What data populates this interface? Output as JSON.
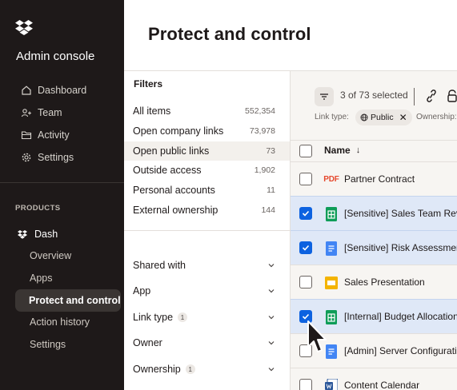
{
  "sidebar": {
    "app_title": "Admin console",
    "nav": [
      {
        "label": "Dashboard",
        "icon": "home-icon"
      },
      {
        "label": "Team",
        "icon": "team-icon"
      },
      {
        "label": "Activity",
        "icon": "folder-icon"
      },
      {
        "label": "Settings",
        "icon": "gear-icon"
      }
    ],
    "products_label": "PRODUCTS",
    "dash": {
      "label": "Dash",
      "icon": "dash-logo-icon"
    },
    "sub_items": [
      "Overview",
      "Apps",
      "Protect and control",
      "Action history",
      "Settings"
    ],
    "active_sub_index": 2
  },
  "header": {
    "title": "Protect and control"
  },
  "filters": {
    "title": "Filters",
    "items": [
      {
        "label": "All items",
        "count": "552,354"
      },
      {
        "label": "Open company links",
        "count": "73,978"
      },
      {
        "label": "Open public links",
        "count": "73"
      },
      {
        "label": "Outside access",
        "count": "1,902"
      },
      {
        "label": "Personal accounts",
        "count": "11"
      },
      {
        "label": "External ownership",
        "count": "144"
      }
    ],
    "selected_index": 2,
    "facets": [
      {
        "label": "Shared with",
        "badge": ""
      },
      {
        "label": "App",
        "badge": ""
      },
      {
        "label": "Link type",
        "badge": "1"
      },
      {
        "label": "Owner",
        "badge": ""
      },
      {
        "label": "Ownership",
        "badge": "1"
      }
    ]
  },
  "toolbar": {
    "selection": "3 of 73 selected",
    "link_type_label": "Link type:",
    "chip_label": "Public",
    "ownership_label": "Ownership:"
  },
  "table": {
    "column_name": "Name",
    "sort_arrow": "↓",
    "rows": [
      {
        "name": "Partner Contract",
        "type": "pdf",
        "icon_text": "PDF",
        "selected": false
      },
      {
        "name": "[Sensitive] Sales Team Revi",
        "type": "sheet",
        "selected": true
      },
      {
        "name": "[Sensitive] Risk Assessmen",
        "type": "doc",
        "selected": true
      },
      {
        "name": "Sales Presentation",
        "type": "slides",
        "selected": false
      },
      {
        "name": "[Internal] Budget Allocation",
        "type": "sheet",
        "selected": true
      },
      {
        "name": "[Admin] Server Configurati",
        "type": "doc",
        "selected": false
      },
      {
        "name": "Content Calendar",
        "type": "word",
        "selected": false
      }
    ]
  },
  "colors": {
    "sidebar_bg": "#1e1919",
    "accent_blue": "#0d62e0",
    "selected_row": "#dfe8f7",
    "pdf_red": "#e5482d",
    "sheet_green": "#0f9d58",
    "doc_blue": "#4285f4",
    "slides_yellow": "#f4b400"
  }
}
